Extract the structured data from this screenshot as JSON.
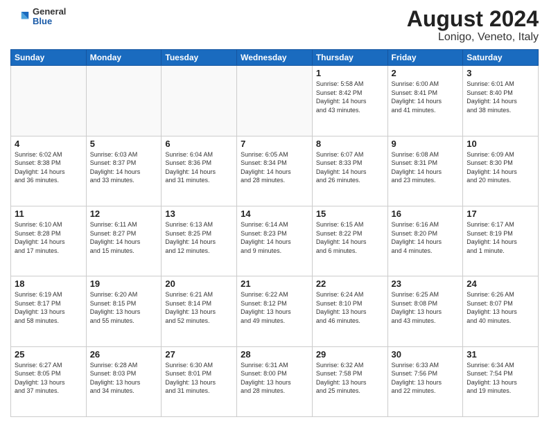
{
  "header": {
    "logo_general": "General",
    "logo_blue": "Blue",
    "title": "August 2024",
    "subtitle": "Lonigo, Veneto, Italy"
  },
  "days_of_week": [
    "Sunday",
    "Monday",
    "Tuesday",
    "Wednesday",
    "Thursday",
    "Friday",
    "Saturday"
  ],
  "weeks": [
    [
      {
        "day": "",
        "info": ""
      },
      {
        "day": "",
        "info": ""
      },
      {
        "day": "",
        "info": ""
      },
      {
        "day": "",
        "info": ""
      },
      {
        "day": "1",
        "info": "Sunrise: 5:58 AM\nSunset: 8:42 PM\nDaylight: 14 hours\nand 43 minutes."
      },
      {
        "day": "2",
        "info": "Sunrise: 6:00 AM\nSunset: 8:41 PM\nDaylight: 14 hours\nand 41 minutes."
      },
      {
        "day": "3",
        "info": "Sunrise: 6:01 AM\nSunset: 8:40 PM\nDaylight: 14 hours\nand 38 minutes."
      }
    ],
    [
      {
        "day": "4",
        "info": "Sunrise: 6:02 AM\nSunset: 8:38 PM\nDaylight: 14 hours\nand 36 minutes."
      },
      {
        "day": "5",
        "info": "Sunrise: 6:03 AM\nSunset: 8:37 PM\nDaylight: 14 hours\nand 33 minutes."
      },
      {
        "day": "6",
        "info": "Sunrise: 6:04 AM\nSunset: 8:36 PM\nDaylight: 14 hours\nand 31 minutes."
      },
      {
        "day": "7",
        "info": "Sunrise: 6:05 AM\nSunset: 8:34 PM\nDaylight: 14 hours\nand 28 minutes."
      },
      {
        "day": "8",
        "info": "Sunrise: 6:07 AM\nSunset: 8:33 PM\nDaylight: 14 hours\nand 26 minutes."
      },
      {
        "day": "9",
        "info": "Sunrise: 6:08 AM\nSunset: 8:31 PM\nDaylight: 14 hours\nand 23 minutes."
      },
      {
        "day": "10",
        "info": "Sunrise: 6:09 AM\nSunset: 8:30 PM\nDaylight: 14 hours\nand 20 minutes."
      }
    ],
    [
      {
        "day": "11",
        "info": "Sunrise: 6:10 AM\nSunset: 8:28 PM\nDaylight: 14 hours\nand 17 minutes."
      },
      {
        "day": "12",
        "info": "Sunrise: 6:11 AM\nSunset: 8:27 PM\nDaylight: 14 hours\nand 15 minutes."
      },
      {
        "day": "13",
        "info": "Sunrise: 6:13 AM\nSunset: 8:25 PM\nDaylight: 14 hours\nand 12 minutes."
      },
      {
        "day": "14",
        "info": "Sunrise: 6:14 AM\nSunset: 8:23 PM\nDaylight: 14 hours\nand 9 minutes."
      },
      {
        "day": "15",
        "info": "Sunrise: 6:15 AM\nSunset: 8:22 PM\nDaylight: 14 hours\nand 6 minutes."
      },
      {
        "day": "16",
        "info": "Sunrise: 6:16 AM\nSunset: 8:20 PM\nDaylight: 14 hours\nand 4 minutes."
      },
      {
        "day": "17",
        "info": "Sunrise: 6:17 AM\nSunset: 8:19 PM\nDaylight: 14 hours\nand 1 minute."
      }
    ],
    [
      {
        "day": "18",
        "info": "Sunrise: 6:19 AM\nSunset: 8:17 PM\nDaylight: 13 hours\nand 58 minutes."
      },
      {
        "day": "19",
        "info": "Sunrise: 6:20 AM\nSunset: 8:15 PM\nDaylight: 13 hours\nand 55 minutes."
      },
      {
        "day": "20",
        "info": "Sunrise: 6:21 AM\nSunset: 8:14 PM\nDaylight: 13 hours\nand 52 minutes."
      },
      {
        "day": "21",
        "info": "Sunrise: 6:22 AM\nSunset: 8:12 PM\nDaylight: 13 hours\nand 49 minutes."
      },
      {
        "day": "22",
        "info": "Sunrise: 6:24 AM\nSunset: 8:10 PM\nDaylight: 13 hours\nand 46 minutes."
      },
      {
        "day": "23",
        "info": "Sunrise: 6:25 AM\nSunset: 8:08 PM\nDaylight: 13 hours\nand 43 minutes."
      },
      {
        "day": "24",
        "info": "Sunrise: 6:26 AM\nSunset: 8:07 PM\nDaylight: 13 hours\nand 40 minutes."
      }
    ],
    [
      {
        "day": "25",
        "info": "Sunrise: 6:27 AM\nSunset: 8:05 PM\nDaylight: 13 hours\nand 37 minutes."
      },
      {
        "day": "26",
        "info": "Sunrise: 6:28 AM\nSunset: 8:03 PM\nDaylight: 13 hours\nand 34 minutes."
      },
      {
        "day": "27",
        "info": "Sunrise: 6:30 AM\nSunset: 8:01 PM\nDaylight: 13 hours\nand 31 minutes."
      },
      {
        "day": "28",
        "info": "Sunrise: 6:31 AM\nSunset: 8:00 PM\nDaylight: 13 hours\nand 28 minutes."
      },
      {
        "day": "29",
        "info": "Sunrise: 6:32 AM\nSunset: 7:58 PM\nDaylight: 13 hours\nand 25 minutes."
      },
      {
        "day": "30",
        "info": "Sunrise: 6:33 AM\nSunset: 7:56 PM\nDaylight: 13 hours\nand 22 minutes."
      },
      {
        "day": "31",
        "info": "Sunrise: 6:34 AM\nSunset: 7:54 PM\nDaylight: 13 hours\nand 19 minutes."
      }
    ]
  ]
}
